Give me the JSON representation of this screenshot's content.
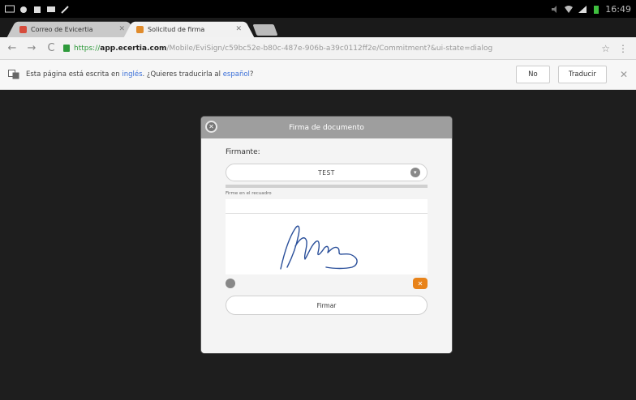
{
  "status_bar": {
    "time": "16:49"
  },
  "tabs": [
    {
      "label": "Correo de Evicertia",
      "favicon_color": "#d64b3b",
      "active": false
    },
    {
      "label": "Solicitud de firma",
      "favicon_color": "#e08b2b",
      "active": true
    }
  ],
  "toolbar": {
    "url_scheme": "https://",
    "url_host": "app.ecertia.com",
    "url_path": "/Mobile/EviSign/c59bc52e-b80c-487e-906b-a39c0112ff2e/Commitment?&ui-state=dialog"
  },
  "infobar": {
    "msg_prefix": "Esta página está escrita en ",
    "source_lang": "inglés",
    "msg_middle": ". ¿Quieres traducirla al ",
    "target_lang": "español",
    "msg_suffix": "?",
    "no_label": "No",
    "translate_label": "Traducir"
  },
  "dialog": {
    "title": "Firma de documento",
    "firmante_label": "Firmante:",
    "firmante_value": "TEST",
    "signature_label": "Firme en el recuadro",
    "submit_label": "Firmar"
  }
}
